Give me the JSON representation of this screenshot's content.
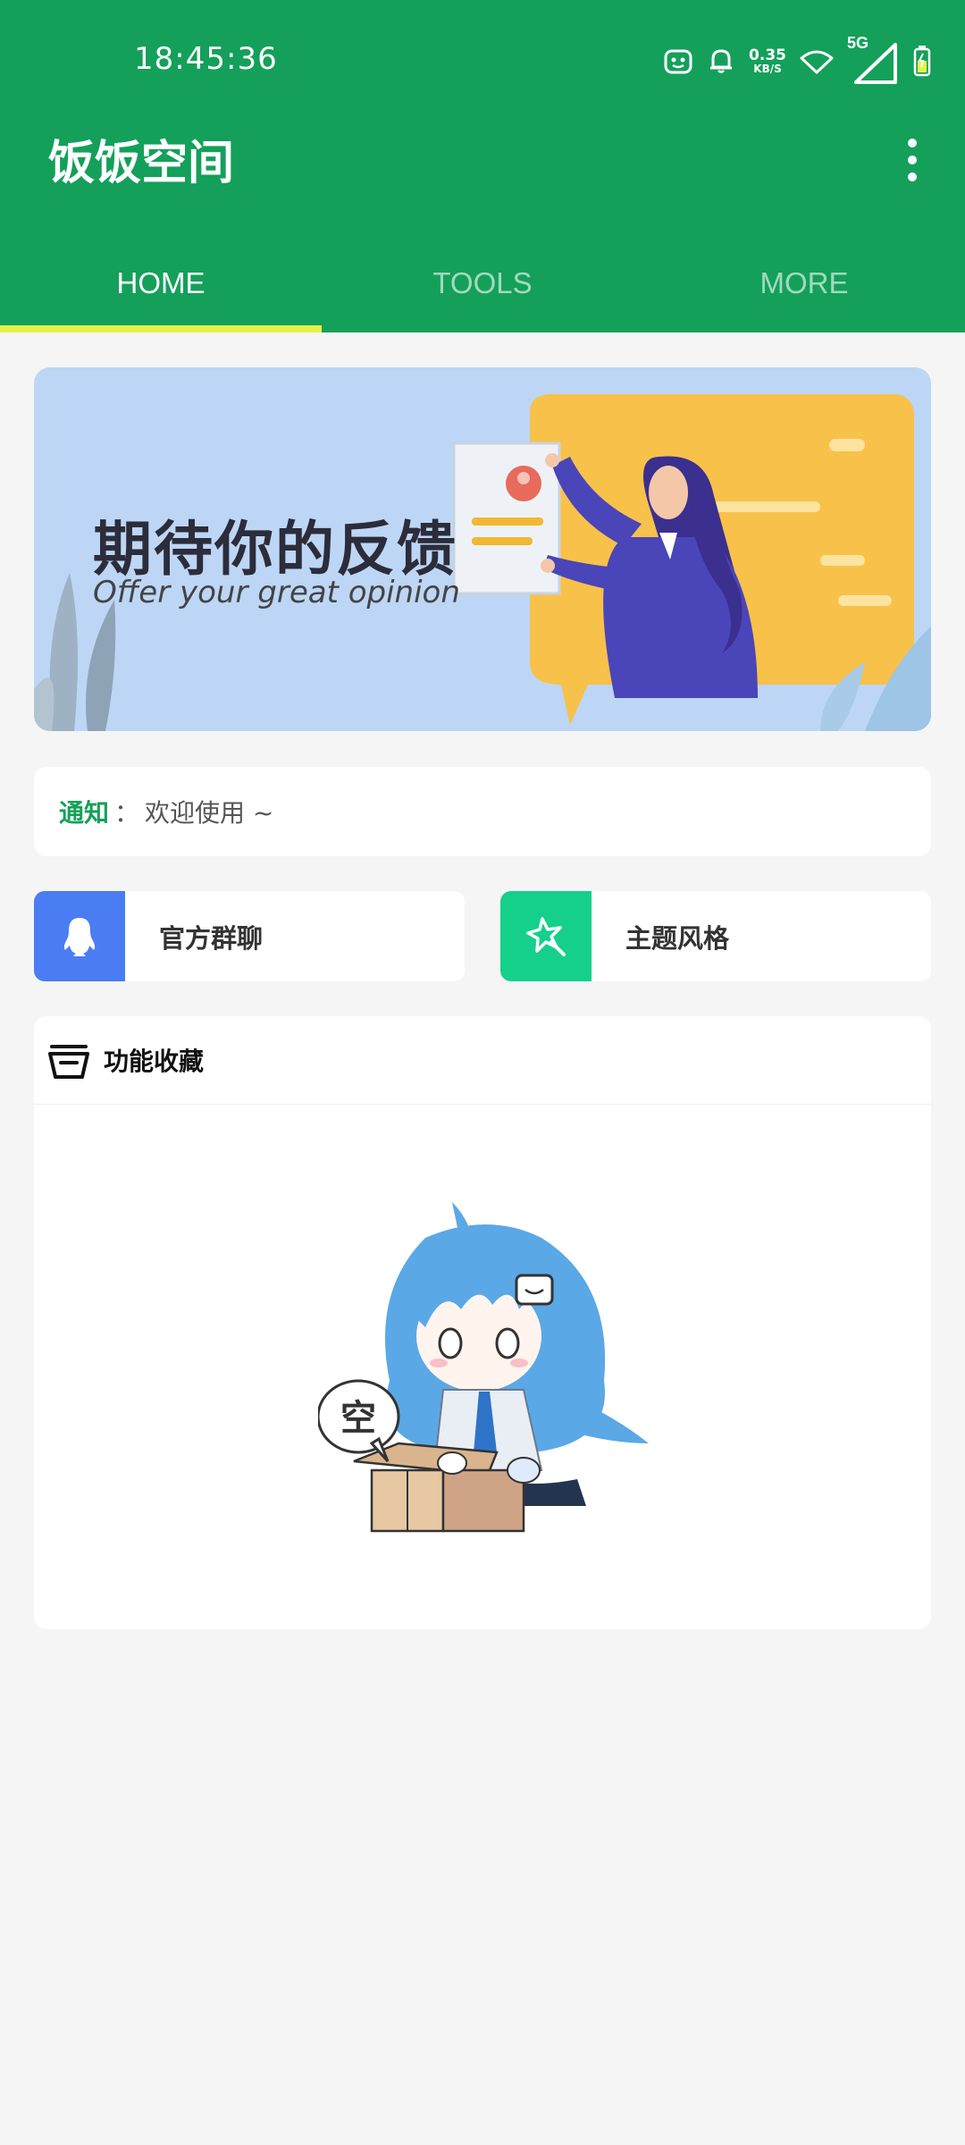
{
  "status_bar": {
    "time": "18:45:36",
    "net_speed_value": "0.35",
    "net_speed_unit": "KB/S",
    "network_type": "5G"
  },
  "app": {
    "title": "饭饭空间"
  },
  "tabs": [
    {
      "label": "HOME",
      "active": true
    },
    {
      "label": "TOOLS",
      "active": false
    },
    {
      "label": "MORE",
      "active": false
    }
  ],
  "banner": {
    "title_cn": "期待你的反馈",
    "title_en": "Offer your great opinion"
  },
  "notice": {
    "label": "通知",
    "separator": "：",
    "text": "欢迎使用 ~"
  },
  "quick_actions": [
    {
      "label": "官方群聊",
      "icon": "qq-penguin-icon",
      "color": "#4a7cf3"
    },
    {
      "label": "主题风格",
      "icon": "magic-wand-icon",
      "color": "#14d08a"
    }
  ],
  "favorites": {
    "title": "功能收藏",
    "icon": "basket-icon",
    "empty_bubble": "空"
  },
  "colors": {
    "primary": "#14a05a",
    "tab_indicator": "#e8f04a",
    "background": "#f5f5f5"
  }
}
